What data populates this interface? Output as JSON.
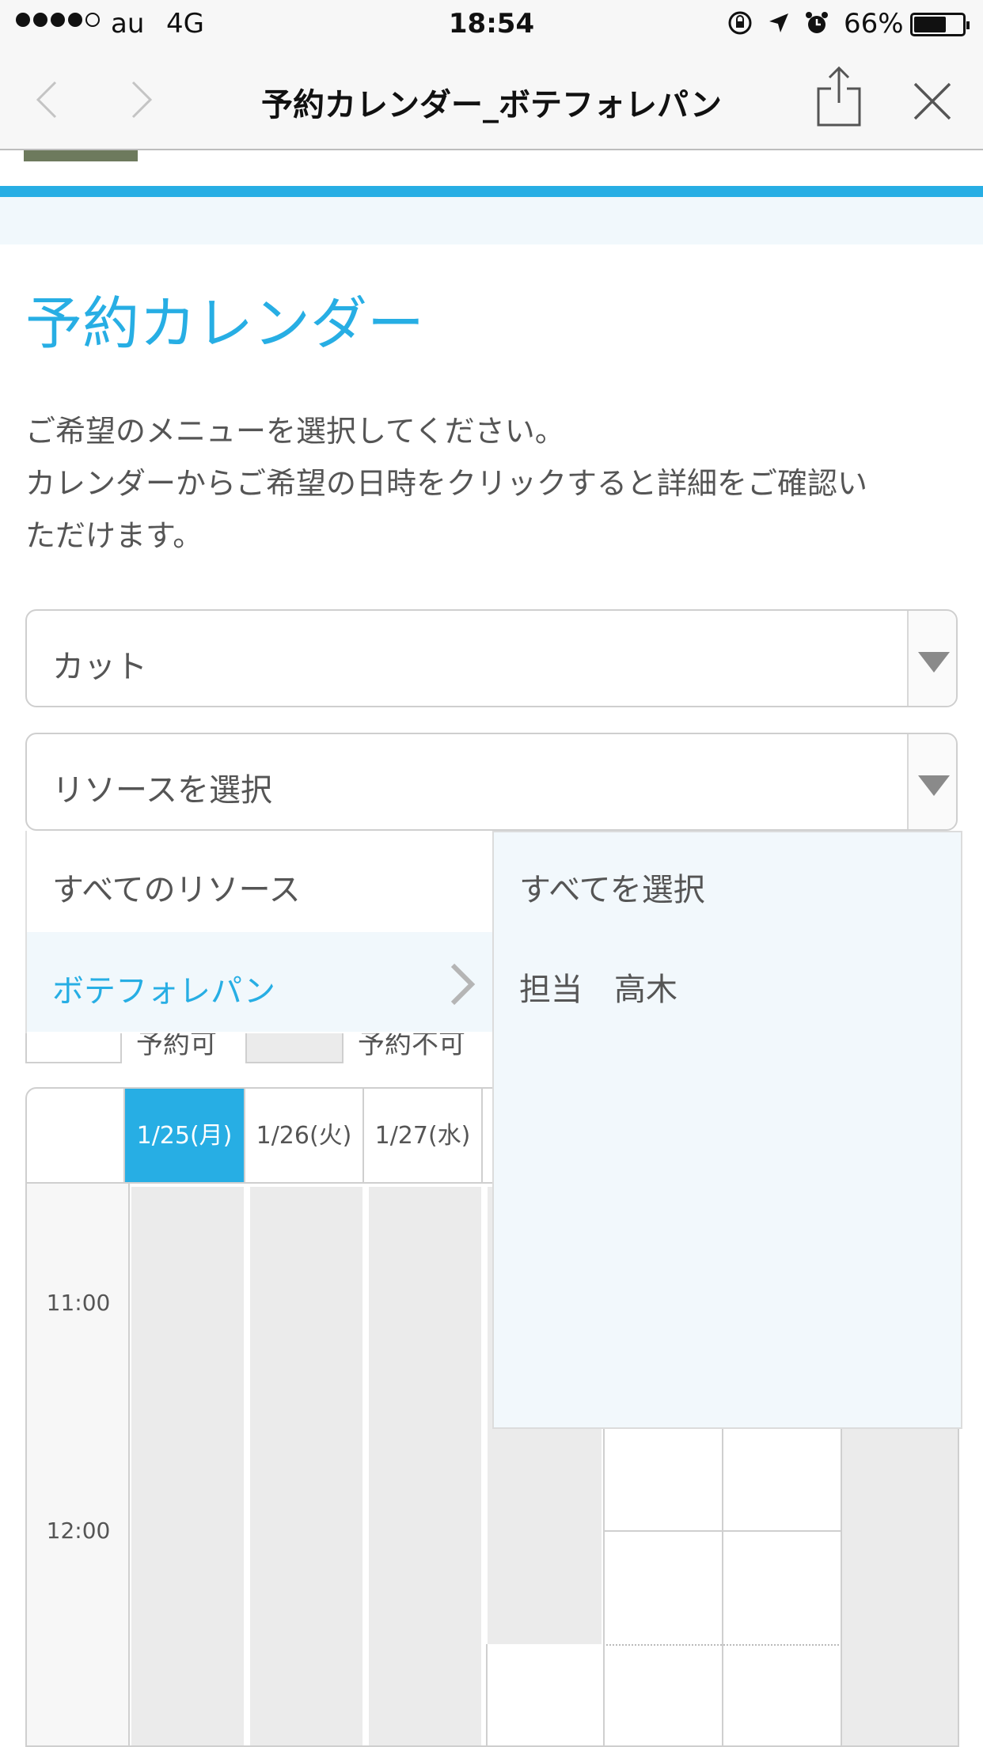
{
  "status_bar": {
    "carrier": "au",
    "network": "4G",
    "time": "18:54",
    "battery_pct": "66%",
    "battery_level": 0.66
  },
  "nav": {
    "title": "予約カレンダー_ボテフォレパン",
    "icons": [
      "back-chevron-icon",
      "forward-chevron-icon",
      "share-icon",
      "close-icon"
    ]
  },
  "colors": {
    "accent": "#27aee4",
    "pale": "#f1f8fc"
  },
  "page": {
    "title": "予約カレンダー",
    "description_lines": [
      "ご希望のメニューを選択してください。",
      "カレンダーからご希望の日時をクリックすると詳細をご確認い",
      "ただけます。"
    ]
  },
  "menu_select": {
    "value": "カット"
  },
  "resource_select": {
    "value": "リソースを選択"
  },
  "resource_dropdown": {
    "left_items": [
      {
        "label": "すべてのリソース",
        "selected": false
      },
      {
        "label": "ボテフォレパン",
        "selected": true
      }
    ],
    "right_items": [
      {
        "label": "すべてを選択"
      },
      {
        "label": "担当　高木"
      }
    ]
  },
  "legend": {
    "available": "予約可",
    "unavailable": "予約不可"
  },
  "calendar": {
    "days": [
      {
        "label": "1/25(月)",
        "active": true
      },
      {
        "label": "1/26(火)",
        "active": false
      },
      {
        "label": "1/27(水)",
        "active": false
      }
    ],
    "times": [
      "11:00",
      "12:00"
    ]
  }
}
